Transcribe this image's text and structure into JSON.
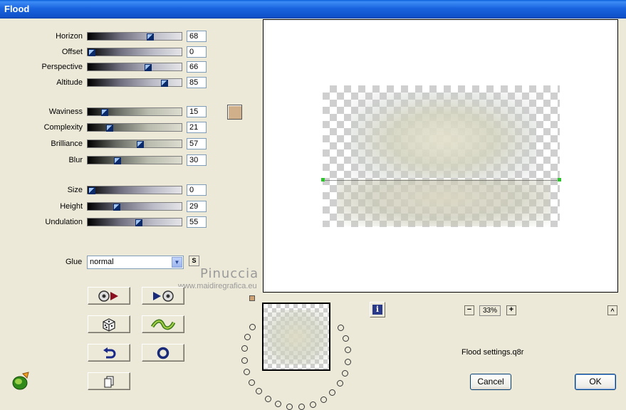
{
  "window": {
    "title": "Flood"
  },
  "sliders": {
    "horizon": {
      "label": "Horizon",
      "value": "68",
      "level": 68
    },
    "offset": {
      "label": "Offset",
      "value": "0",
      "level": 0
    },
    "perspective": {
      "label": "Perspective",
      "value": "66",
      "level": 66
    },
    "altitude": {
      "label": "Altitude",
      "value": "85",
      "level": 85
    },
    "waviness": {
      "label": "Waviness",
      "value": "15",
      "level": 15
    },
    "complexity": {
      "label": "Complexity",
      "value": "21",
      "level": 21
    },
    "brilliance": {
      "label": "Brilliance",
      "value": "57",
      "level": 57
    },
    "blur": {
      "label": "Blur",
      "value": "30",
      "level": 30
    },
    "size": {
      "label": "Size",
      "value": "0",
      "level": 0
    },
    "height": {
      "label": "Height",
      "value": "29",
      "level": 29
    },
    "undulation": {
      "label": "Undulation",
      "value": "55",
      "level": 55
    }
  },
  "color_swatch": "#cfb08a",
  "glue": {
    "label": "Glue",
    "value": "normal",
    "s_label": "S"
  },
  "watermark": {
    "line1": "Pinuccia",
    "line2": "www.maidiregrafica.eu"
  },
  "tool_buttons": [
    {
      "icon": "previous-preset-icon"
    },
    {
      "icon": "next-preset-icon"
    },
    {
      "icon": "random-dice-icon"
    },
    {
      "icon": "wave-icon"
    },
    {
      "icon": "undo-icon"
    },
    {
      "icon": "reset-ring-icon"
    },
    {
      "icon": "copy-page-icon"
    }
  ],
  "zoom": {
    "value": "33%",
    "minus": "−",
    "plus": "+"
  },
  "info_label": "i",
  "scroll_up_label": "^",
  "settings_file": "Flood settings.q8r",
  "buttons": {
    "cancel": "Cancel",
    "ok": "OK"
  },
  "accent_colors": {
    "title_bar": "#0a5fd8",
    "horizon_marker": "#2ec42e"
  }
}
